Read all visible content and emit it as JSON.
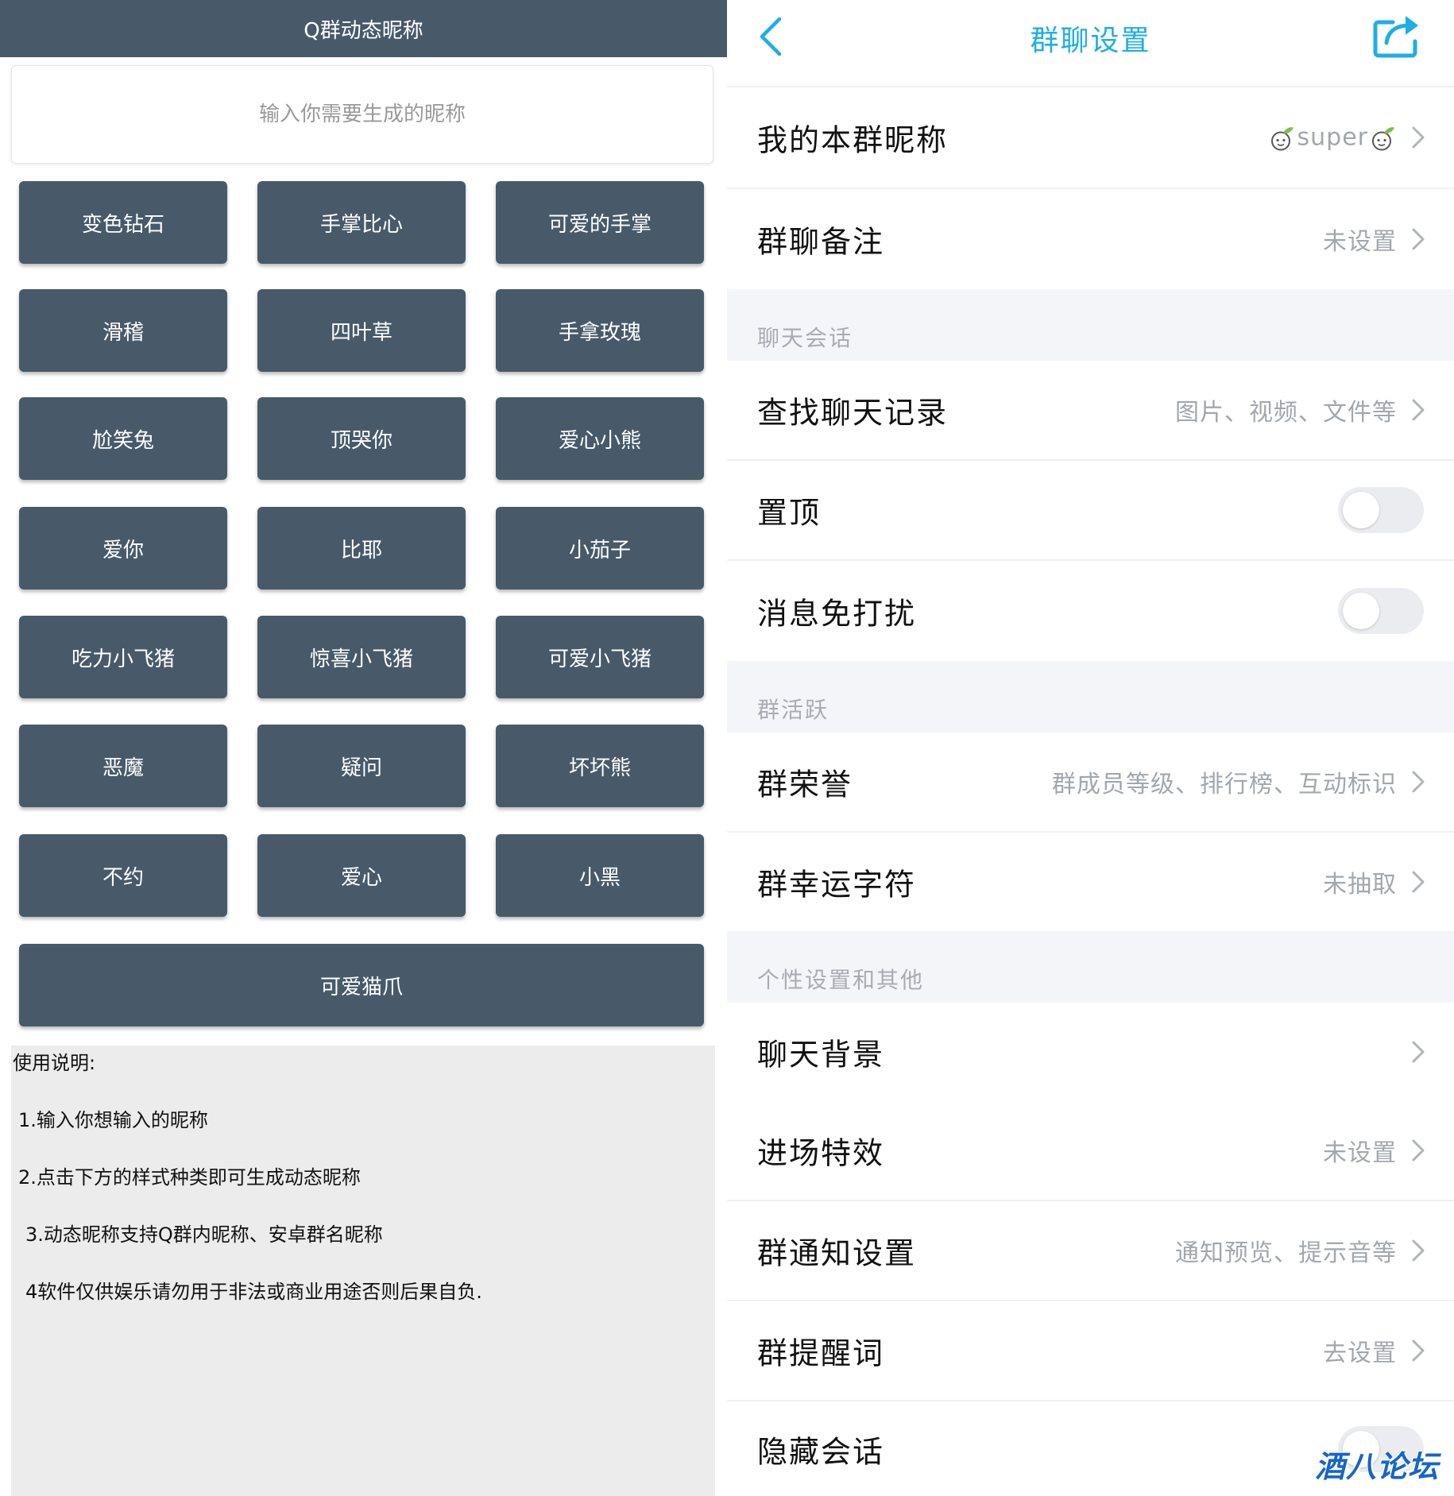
{
  "left": {
    "header_title": "Q群动态昵称",
    "input_placeholder": "输入你需要生成的昵称",
    "buttons": [
      "变色钻石",
      "手掌比心",
      "可爱的手掌",
      "滑稽",
      "四叶草",
      "手拿玫瑰",
      "尬笑兔",
      "顶哭你",
      "爱心小熊",
      "爱你",
      "比耶",
      "小茄子",
      "吃力小飞猪",
      "惊喜小飞猪",
      "可爱小飞猪",
      "恶魔",
      "疑问",
      "坏坏熊",
      "不约",
      "爱心",
      "小黑"
    ],
    "wide_button": "可爱猫爪",
    "instructions": {
      "title": "使用说明:",
      "lines": [
        "1.输入你想输入的昵称",
        "2.点击下方的样式种类即可生成动态昵称",
        "3.动态昵称支持Q群内昵称、安卓群名昵称",
        "4软件仅供娱乐请勿用于非法或商业用途否则后果自负."
      ]
    },
    "colors": {
      "header_bg": "#485a6a",
      "button_bg": "#485a6a"
    }
  },
  "right": {
    "title": "群聊设置",
    "rows": {
      "my_nick": {
        "label": "我的本群昵称",
        "value": "super"
      },
      "remark": {
        "label": "群聊备注",
        "value": "未设置"
      },
      "search": {
        "label": "查找聊天记录",
        "value": "图片、视频、文件等"
      },
      "pin": {
        "label": "置顶",
        "on": false
      },
      "mute": {
        "label": "消息免打扰",
        "on": false
      },
      "honor": {
        "label": "群荣誉",
        "value": "群成员等级、排行榜、互动标识"
      },
      "lucky": {
        "label": "群幸运字符",
        "value": "未抽取"
      },
      "background": {
        "label": "聊天背景"
      },
      "entry": {
        "label": "进场特效",
        "value": "未设置"
      },
      "notify": {
        "label": "群通知设置",
        "value": "通知预览、提示音等"
      },
      "remind": {
        "label": "群提醒词",
        "value": "去设置"
      },
      "hide": {
        "label": "隐藏会话"
      }
    },
    "sections": {
      "chat": "聊天会话",
      "active": "群活跃",
      "personal": "个性设置和其他"
    },
    "colors": {
      "accent": "#1eaee6"
    }
  },
  "watermark": "酒八论坛",
  "icons": {
    "back": "back-chevron-icon",
    "share": "share-icon",
    "chevron": "chevron-right-icon",
    "nick_decoration": "cabbage-emoji-icon"
  }
}
